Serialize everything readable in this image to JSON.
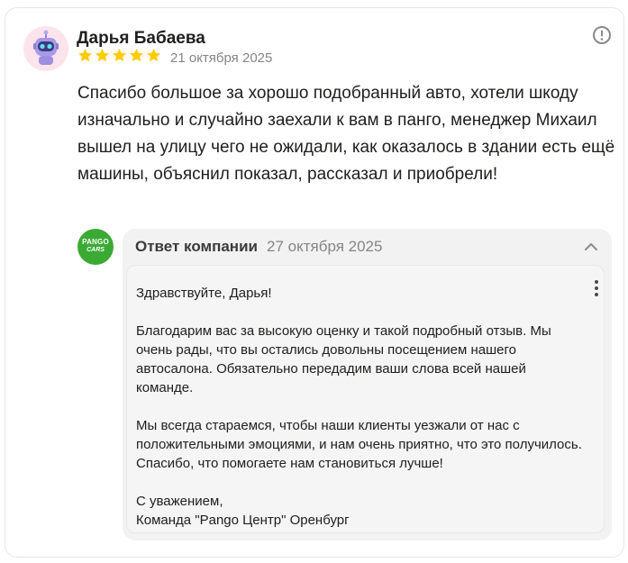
{
  "review": {
    "author": "Дарья Бабаева",
    "rating": 5,
    "rating_max": 5,
    "date": "21 октября 2025",
    "text": "Спасибо большое за хорошо подобранный авто, хотели шкоду изначально и случайно заехали к вам в панго, менеджер Михаил вышел на улицу чего не ожидали, как оказалось в здании есть ещё машины, объяснил показал, рассказал и приобрели!",
    "avatar_icon": "robot-avatar-icon",
    "star_color": "#fc0"
  },
  "company": {
    "logo_line1": "PANGO",
    "logo_line2": "CARS",
    "logo_color": "#3aaa35"
  },
  "reply": {
    "title": "Ответ компании",
    "date": "27 октября 2025",
    "paragraphs": [
      "Здравствуйте, Дарья!",
      "Благодарим вас за высокую оценку и такой подробный отзыв. Мы очень рады, что вы остались довольны посещением нашего автосалона. Обязательно передадим ваши слова всей нашей команде.",
      "Мы всегда стараемся, чтобы наши клиенты уезжали от нас с положительными эмоциями, и нам очень приятно, что это получилось. Спасибо, что помогаете нам становиться лучше!"
    ],
    "signature_line1": "С уважением,",
    "signature_line2": "Команда \"Pango Центр\" Оренбург"
  }
}
